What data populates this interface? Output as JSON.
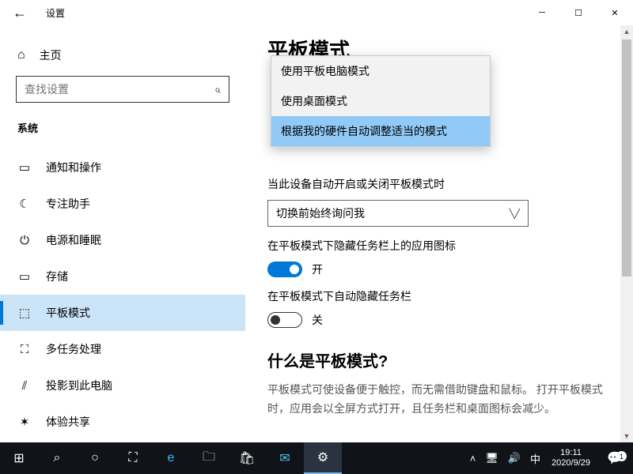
{
  "titlebar": {
    "title": "设置"
  },
  "sidebar": {
    "home": "主页",
    "search_placeholder": "查找设置",
    "section": "系统",
    "items": [
      {
        "icon": "💬",
        "label": "通知和操作"
      },
      {
        "icon": "☾",
        "label": "专注助手"
      },
      {
        "icon": "⏻",
        "label": "电源和睡眠"
      },
      {
        "icon": "💾",
        "label": "存储"
      },
      {
        "icon": "⬚",
        "label": "平板模式"
      },
      {
        "icon": "⛶",
        "label": "多任务处理"
      },
      {
        "icon": "⫽",
        "label": "投影到此电脑"
      },
      {
        "icon": "✶",
        "label": "体验共享"
      }
    ]
  },
  "main": {
    "title": "平板模式",
    "dropdown_options": [
      "使用平板电脑模式",
      "使用桌面模式",
      "根据我的硬件自动调整适当的模式"
    ],
    "q2_label": "当此设备自动开启或关闭平板模式时",
    "q2_value": "切换前始终询问我",
    "t1_label": "在平板模式下隐藏任务栏上的应用图标",
    "t1_state": "开",
    "t2_label": "在平板模式下自动隐藏任务栏",
    "t2_state": "关",
    "about_title": "什么是平板模式?",
    "about_desc": "平板模式可使设备便于触控，而无需借助键盘和鼠标。 打开平板模式时，应用会以全屏方式打开，且任务栏和桌面图标会减少。"
  },
  "taskbar": {
    "ime": "中",
    "time": "19:11",
    "date": "2020/9/29",
    "notif_count": "1"
  }
}
